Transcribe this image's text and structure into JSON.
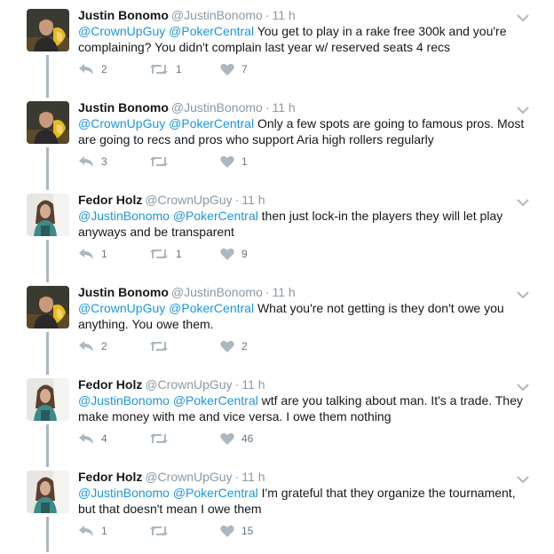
{
  "colors": {
    "mention": "#1b95e0",
    "meta": "#8899a6",
    "action_icon": "#aab8c2",
    "connector": "#aab8c2"
  },
  "tweets": [
    {
      "author": "Justin Bonomo",
      "handle": "@JustinBonomo",
      "time": "11 h",
      "mention1": "@CrownUpGuy",
      "mention2": "@PokerCentral",
      "body": "You get to play in a rake free 300k and you're complaining? You didn't complain last year w/ reserved seats 4 recs",
      "replies": "2",
      "retweets": "1",
      "likes": "7",
      "avatar": "justin-avatar"
    },
    {
      "author": "Justin Bonomo",
      "handle": "@JustinBonomo",
      "time": "11 h",
      "mention1": "@CrownUpGuy",
      "mention2": "@PokerCentral",
      "body": "Only a few spots are going to famous pros. Most are going to recs and pros who support Aria high rollers regularly",
      "replies": "3",
      "retweets": "",
      "likes": "1",
      "avatar": "justin-avatar"
    },
    {
      "author": "Fedor Holz",
      "handle": "@CrownUpGuy",
      "time": "11 h",
      "mention1": "@JustinBonomo",
      "mention2": "@PokerCentral",
      "body": "then just lock-in the players they will let play anyways and be transparent",
      "replies": "1",
      "retweets": "1",
      "likes": "9",
      "avatar": "fedor-avatar"
    },
    {
      "author": "Justin Bonomo",
      "handle": "@JustinBonomo",
      "time": "11 h",
      "mention1": "@CrownUpGuy",
      "mention2": "@PokerCentral",
      "body": "What you're not getting is they don't owe you anything. You owe them.",
      "replies": "2",
      "retweets": "",
      "likes": "2",
      "avatar": "justin-avatar"
    },
    {
      "author": "Fedor Holz",
      "handle": "@CrownUpGuy",
      "time": "11 h",
      "mention1": "@JustinBonomo",
      "mention2": "@PokerCentral",
      "body": "wtf are you talking about man. It's a trade. They make money with me and vice versa. I owe them nothing",
      "replies": "4",
      "retweets": "",
      "likes": "46",
      "avatar": "fedor-avatar"
    },
    {
      "author": "Fedor Holz",
      "handle": "@CrownUpGuy",
      "time": "11 h",
      "mention1": "@JustinBonomo",
      "mention2": "@PokerCentral",
      "body": "I'm grateful that they organize the tournament, but that doesn't mean I owe them",
      "replies": "1",
      "retweets": "",
      "likes": "15",
      "avatar": "fedor-avatar"
    }
  ]
}
